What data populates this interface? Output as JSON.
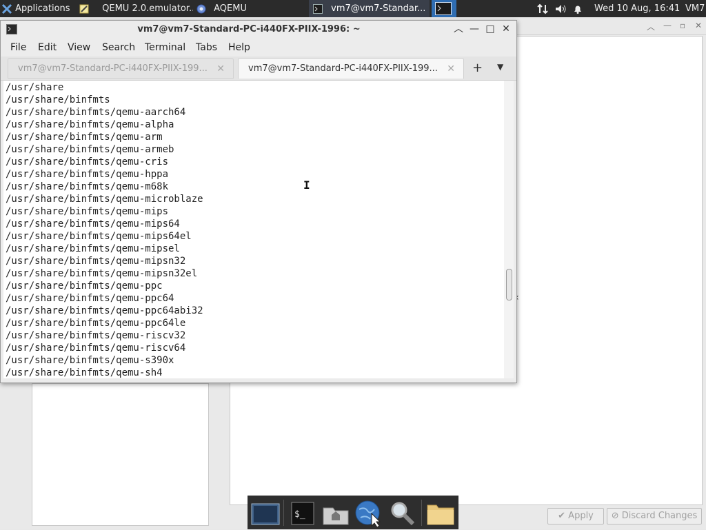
{
  "top_panel": {
    "applications_label": "Applications",
    "tasks": [
      {
        "label": "QEMU 2.0.emulator...",
        "icon": "text-editor-icon"
      },
      {
        "label": "AQEMU",
        "icon": "aqemu-icon"
      },
      {
        "label": "vm7@vm7-Standar...",
        "icon": "terminal-icon"
      }
    ],
    "datetime": "Wed 10 Aug, 16:41",
    "user": "VM7"
  },
  "terminal": {
    "title": "vm7@vm7-Standard-PC-i440FX-PIIX-1996: ~",
    "menu": [
      "File",
      "Edit",
      "View",
      "Search",
      "Terminal",
      "Tabs",
      "Help"
    ],
    "tabs": [
      {
        "label": "vm7@vm7-Standard-PC-i440FX-PIIX-199...",
        "active": false
      },
      {
        "label": "vm7@vm7-Standard-PC-i440FX-PIIX-199...",
        "active": true
      }
    ],
    "output_lines": [
      "/usr/share",
      "/usr/share/binfmts",
      "/usr/share/binfmts/qemu-aarch64",
      "/usr/share/binfmts/qemu-alpha",
      "/usr/share/binfmts/qemu-arm",
      "/usr/share/binfmts/qemu-armeb",
      "/usr/share/binfmts/qemu-cris",
      "/usr/share/binfmts/qemu-hppa",
      "/usr/share/binfmts/qemu-m68k",
      "/usr/share/binfmts/qemu-microblaze",
      "/usr/share/binfmts/qemu-mips",
      "/usr/share/binfmts/qemu-mips64",
      "/usr/share/binfmts/qemu-mips64el",
      "/usr/share/binfmts/qemu-mipsel",
      "/usr/share/binfmts/qemu-mipsn32",
      "/usr/share/binfmts/qemu-mipsn32el",
      "/usr/share/binfmts/qemu-ppc",
      "/usr/share/binfmts/qemu-ppc64",
      "/usr/share/binfmts/qemu-ppc64abi32",
      "/usr/share/binfmts/qemu-ppc64le",
      "/usr/share/binfmts/qemu-riscv32",
      "/usr/share/binfmts/qemu-riscv64",
      "/usr/share/binfmts/qemu-s390x",
      "/usr/share/binfmts/qemu-sh4"
    ]
  },
  "background_window": {
    "apply_label": "Apply",
    "discard_label": "Discard Changes"
  },
  "dock": {
    "items": [
      "desktop-icon",
      "terminal-icon",
      "home-folder-icon",
      "web-browser-icon",
      "search-icon",
      "file-manager-icon"
    ]
  },
  "colors": {
    "panel_bg": "#2b2b2b",
    "active_task_bg": "#2f6db2",
    "terminal_bg": "#ffffff"
  }
}
